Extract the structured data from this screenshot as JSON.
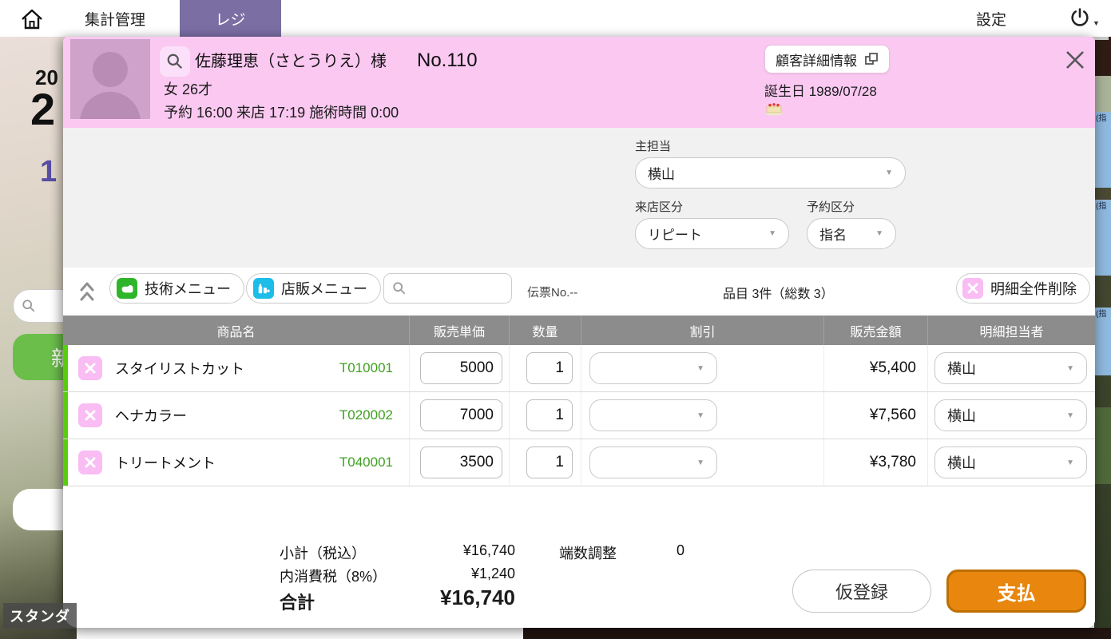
{
  "colors": {
    "header_pink": "#fac8f1",
    "tab_purple": "#7a6ea3",
    "pay_orange": "#e8860d",
    "row_green": "#59cc0c",
    "code_green": "#3fa121",
    "tech_icon_green": "#2fb52a",
    "retail_icon_cyan": "#1cbde8",
    "pink_icon": "#f9bcf3",
    "table_header_gray": "#8c8c8c"
  },
  "topbar": {
    "tab_summary": "集計管理",
    "tab_register": "レジ",
    "settings": "設定"
  },
  "left_panel": {
    "year_fragment": "20",
    "day_fragment": "2",
    "time_fragment": "1",
    "new_button": "新",
    "mode_label": "スタンダ"
  },
  "right_panel": {
    "entries": [
      "(指",
      "(指",
      "(指"
    ]
  },
  "customer": {
    "name": "佐藤理恵（さとうりえ）様",
    "number": "No.110",
    "gender_age": "女  26才",
    "visit_line": "予約 16:00  来店 17:19  施術時間 0:00",
    "detail_button": "顧客詳細情報",
    "birthday": "誕生日 1989/07/28"
  },
  "form": {
    "main_staff_label": "主担当",
    "main_staff_value": "横山",
    "visit_type_label": "来店区分",
    "visit_type_value": "リピート",
    "reserve_type_label": "予約区分",
    "reserve_type_value": "指名"
  },
  "toolbar": {
    "tech_menu": "技術メニュー",
    "retail_menu": "店販メニュー",
    "slip_no": "伝票No.--",
    "item_count": "品目 3件（総数 3）",
    "delete_all": "明細全件削除"
  },
  "table": {
    "headers": [
      "商品名",
      "販売単価",
      "数量",
      "割引",
      "販売金額",
      "明細担当者"
    ],
    "rows": [
      {
        "name": "スタイリストカット",
        "code": "T010001",
        "unit_price": "5000",
        "qty": "1",
        "discount": "",
        "amount": "¥5,400",
        "staff": "横山"
      },
      {
        "name": "ヘナカラー",
        "code": "T020002",
        "unit_price": "7000",
        "qty": "1",
        "discount": "",
        "amount": "¥7,560",
        "staff": "横山"
      },
      {
        "name": "トリートメント",
        "code": "T040001",
        "unit_price": "3500",
        "qty": "1",
        "discount": "",
        "amount": "¥3,780",
        "staff": "横山"
      }
    ]
  },
  "footer": {
    "subtotal_label": "小計（税込）",
    "subtotal": "¥16,740",
    "rounding_label": "端数調整",
    "rounding": "0",
    "tax_label": "内消費税（8%）",
    "tax": "¥1,240",
    "total_label": "合計",
    "total": "¥16,740",
    "draft_button": "仮登録",
    "pay_button": "支払"
  }
}
